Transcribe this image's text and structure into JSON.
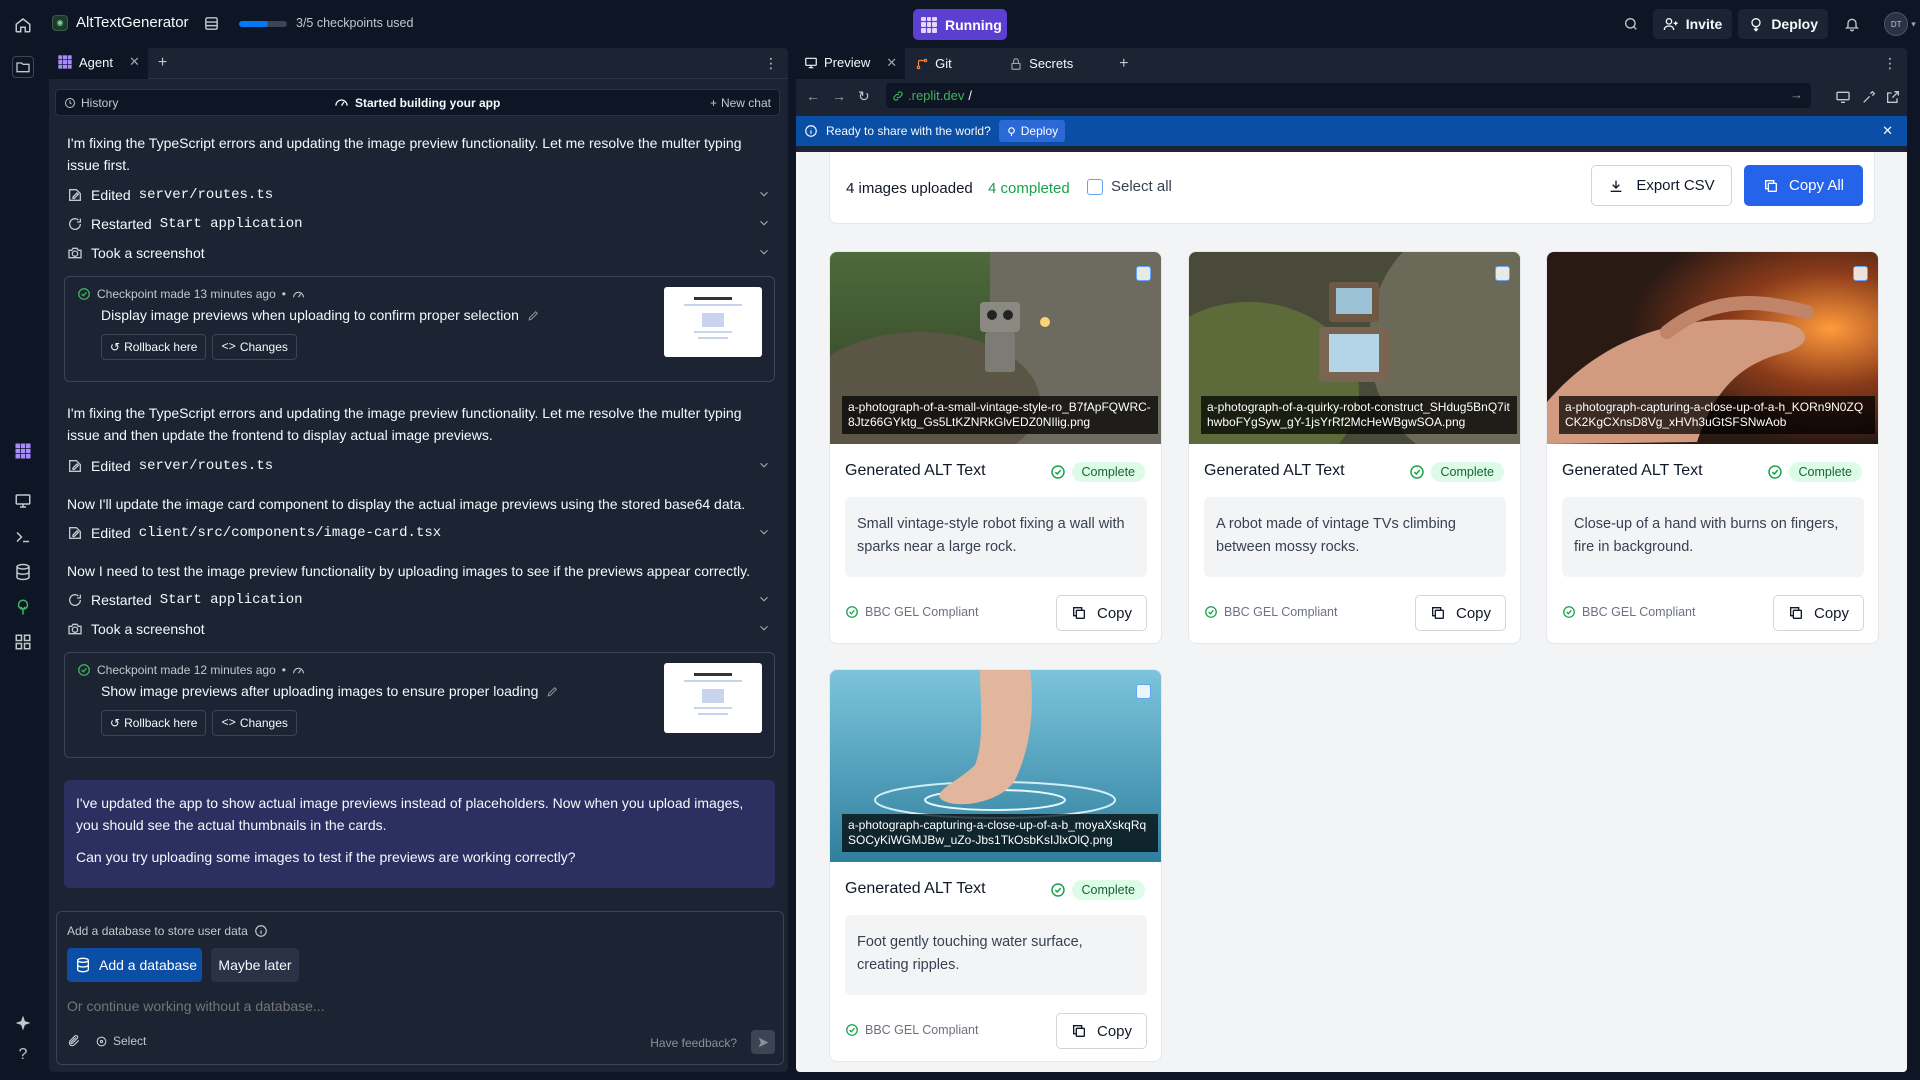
{
  "topbar": {
    "app_name": "AltTextGenerator",
    "checkpoints_text": "3/5 checkpoints used",
    "checkpoints_progress": 0.6,
    "status_label": "Running",
    "invite_label": "Invite",
    "deploy_label": "Deploy",
    "avatar_initials": "DT"
  },
  "agent": {
    "tab_label": "Agent",
    "history_label": "History",
    "status_text": "Started building your app",
    "new_chat_label": "New chat",
    "messages": [
      "I'm fixing the TypeScript errors and updating the image preview functionality. Let me resolve the multer typing issue first.",
      "I'm fixing the TypeScript errors and updating the image preview functionality. Let me resolve the multer typing issue and then update the frontend to display actual image previews.",
      "Now I'll update the image card component to display the actual image previews using the stored base64 data.",
      "Now I need to test the image preview functionality by uploading images to see if the previews appear correctly."
    ],
    "actions": [
      {
        "verb": "Edited",
        "target": "server/routes.ts"
      },
      {
        "verb": "Restarted",
        "target": "Start application"
      },
      {
        "verb": "Took a screenshot",
        "target": ""
      },
      {
        "verb": "Edited",
        "target": "server/routes.ts"
      },
      {
        "verb": "Edited",
        "target": "client/src/components/image-card.tsx"
      },
      {
        "verb": "Restarted",
        "target": "Start application"
      },
      {
        "verb": "Took a screenshot",
        "target": ""
      }
    ],
    "checkpoints": [
      {
        "meta": "Checkpoint made 13 minutes ago",
        "title": "Display image previews when uploading to confirm proper selection"
      },
      {
        "meta": "Checkpoint made 12 minutes ago",
        "title": "Show image previews after uploading images to ensure proper loading"
      }
    ],
    "rollback_label": "Rollback here",
    "changes_label": "Changes",
    "final_message": [
      "I've updated the app to show actual image previews instead of placeholders. Now when you upload images, you should see the actual thumbnails in the cards.",
      "Can you try uploading some images to test if the previews are working correctly?"
    ],
    "db_prompt": {
      "question": "Add a database to store user data",
      "add_label": "Add a database",
      "later_label": "Maybe later",
      "input_placeholder": "Or continue working without a database...",
      "select_label": "Select",
      "feedback_label": "Have feedback?"
    }
  },
  "preview": {
    "tabs": [
      "Preview",
      "Git",
      "Secrets"
    ],
    "url_domain": ".replit.dev",
    "url_path": "/",
    "banner_text": "Ready to share with the world?",
    "banner_deploy": "Deploy"
  },
  "app": {
    "images_uploaded": "4 images uploaded",
    "completed": "4 completed",
    "select_all": "Select all",
    "export_label": "Export CSV",
    "copy_all_label": "Copy All",
    "card_title": "Generated ALT Text",
    "badge_label": "Complete",
    "compliant_label": "BBC GEL Compliant",
    "copy_label": "Copy",
    "cards": [
      {
        "filename": "a-photograph-of-a-small-vintage-style-ro_B7fApFQWRC-8Jtz66GYktg_Gs5LtKZNRkGlvEDZ0NIlig.png",
        "alt": "Small vintage-style robot fixing a wall with sparks near a large rock."
      },
      {
        "filename": "a-photograph-of-a-quirky-robot-construct_SHdug5BnQ7ithwboFYgSyw_gY-1jsYrRf2McHeWBgwSOA.png",
        "alt": "A robot made of vintage TVs climbing between mossy rocks."
      },
      {
        "filename": "a-photograph-capturing-a-close-up-of-a-h_KORn9N0ZQCK2KgCXnsD8Vg_xHVh3uGtSFSNwAob",
        "alt": "Close-up of a hand with burns on fingers, fire in background."
      },
      {
        "filename": "a-photograph-capturing-a-close-up-of-a-b_moyaXskqRqSOCyKiWGMJBw_uZo-Jbs1TkOsbKsIJlxOlQ.png",
        "alt": "Foot gently touching water surface, creating ripples."
      }
    ]
  }
}
